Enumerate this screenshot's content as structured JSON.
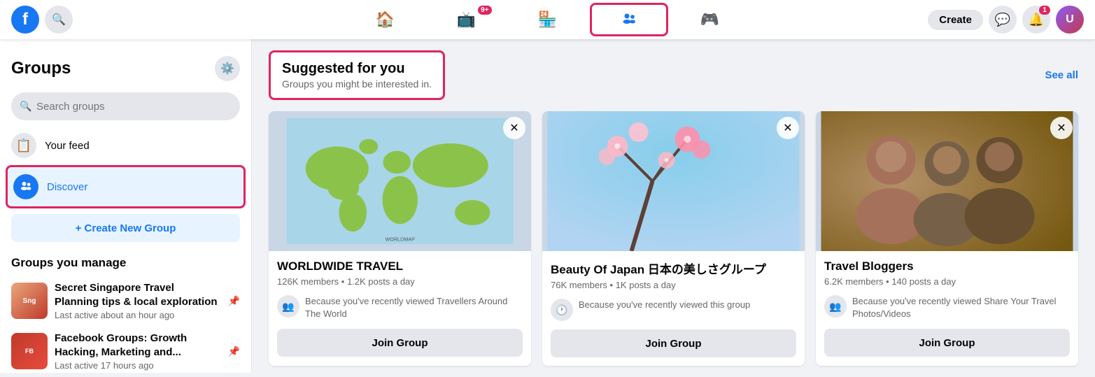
{
  "topnav": {
    "logo": "f",
    "create_label": "Create",
    "notification_count": "9+",
    "alert_count": "1",
    "nav_items": [
      {
        "id": "home",
        "icon": "🏠",
        "label": "Home",
        "active": false
      },
      {
        "id": "video",
        "icon": "📺",
        "label": "Video",
        "active": false,
        "badge": "9+"
      },
      {
        "id": "marketplace",
        "icon": "🏪",
        "label": "Marketplace",
        "active": false
      },
      {
        "id": "groups",
        "icon": "👥",
        "label": "Groups",
        "active": true,
        "highlighted": true
      },
      {
        "id": "gaming",
        "icon": "🎮",
        "label": "Gaming",
        "active": false
      }
    ]
  },
  "sidebar": {
    "title": "Groups",
    "search_placeholder": "Search groups",
    "nav_items": [
      {
        "id": "your-feed",
        "label": "Your feed",
        "icon": "📋"
      },
      {
        "id": "discover",
        "label": "Discover",
        "icon": "🔍",
        "active": true
      }
    ],
    "create_label": "+ Create New Group",
    "manage_title": "Groups you manage",
    "managed_groups": [
      {
        "id": 1,
        "name": "Secret Singapore Travel Planning tips & local exploration",
        "last_active": "Last active about an hour ago",
        "color": "#e8a87c"
      },
      {
        "id": 2,
        "name": "Facebook Groups: Growth Hacking, Marketing and...",
        "last_active": "Last active 17 hours ago",
        "color": "#c0392b"
      }
    ]
  },
  "main": {
    "suggested_title": "Suggested for you",
    "suggested_sub": "Groups you might be interested in.",
    "see_all": "See all",
    "cards": [
      {
        "id": 1,
        "name": "WORLDWIDE TRAVEL",
        "members": "126K members",
        "posts": "1.2K posts a day",
        "reason": "Because you've recently viewed Travellers Around The World",
        "reason_icon": "👥",
        "join_label": "Join Group"
      },
      {
        "id": 2,
        "name": "Beauty Of Japan 日本の美しさグループ",
        "members": "76K members",
        "posts": "1K posts a day",
        "reason": "Because you've recently viewed this group",
        "reason_icon": "🕐",
        "join_label": "Join Group"
      },
      {
        "id": 3,
        "name": "Travel Bloggers",
        "members": "6.2K members",
        "posts": "140 posts a day",
        "reason": "Because you've recently viewed Share Your Travel Photos/Videos",
        "reason_icon": "👥",
        "join_label": "Join Group"
      }
    ]
  }
}
